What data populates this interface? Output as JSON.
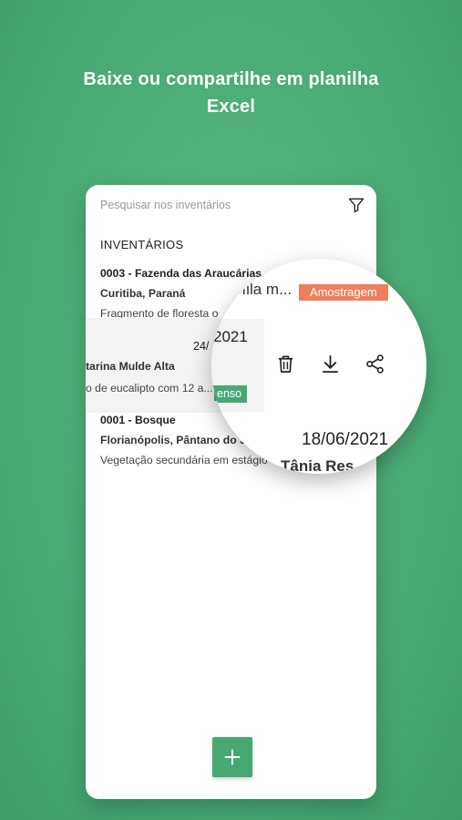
{
  "headline": {
    "line1": "Baixe ou compartilhe em planilha",
    "line2": "Excel"
  },
  "search": {
    "placeholder": "Pesquisar nos inventários",
    "icon": "filter-icon"
  },
  "section_title": "INVENTÁRIOS",
  "inventories": [
    {
      "code": "0003 - Fazenda das Araucárias",
      "location": "Curitiba, Paraná",
      "description": "Fragmento de floresta o"
    },
    {
      "date": "24/",
      "location": "tarina Mulde Alta",
      "description": "o de eucalipto com 12 a...",
      "badge": "enso"
    },
    {
      "code": "0001 - Bosque",
      "location": "Florianópolis, Pântano do S",
      "description": "Vegetação secundária em estágio"
    }
  ],
  "magnifier": {
    "fragment": "ofila m...",
    "badge": "Amostragem",
    "badge_color": "#ee7f5d",
    "date_fragment": "2021",
    "actions": [
      "trash-icon",
      "download-icon",
      "share-icon"
    ],
    "lenso_badge": "enso",
    "date": "18/06/2021",
    "author": "Tânia Res"
  },
  "fab": {
    "icon": "plus-icon"
  },
  "colors": {
    "background": "#4caf79",
    "accent": "#47a873",
    "badge_orange": "#ee7f5d"
  }
}
